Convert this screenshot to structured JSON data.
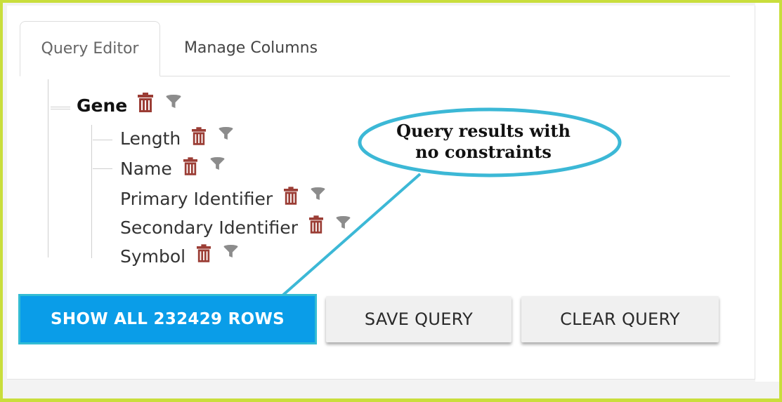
{
  "tabs": [
    {
      "label": "Query Editor",
      "active": true
    },
    {
      "label": "Manage Columns",
      "active": false
    }
  ],
  "tree": {
    "root": {
      "label": "Gene"
    },
    "children": [
      {
        "label": "Length"
      },
      {
        "label": "Name"
      },
      {
        "label": "Primary Identifier"
      },
      {
        "label": "Secondary Identifier"
      },
      {
        "label": "Symbol"
      }
    ]
  },
  "buttons": {
    "show_all": "SHOW ALL 232429 ROWS",
    "save_query": "SAVE QUERY",
    "clear_query": "CLEAR QUERY"
  },
  "callout": {
    "line1": "Query results with",
    "line2": "no constraints"
  },
  "icons": {
    "remove": "trash-icon",
    "constraint": "filter-icon"
  },
  "colors": {
    "frame_border": "#c9de3c",
    "primary_button": "#0a9de8",
    "callout_stroke": "#3cb8d6",
    "trash": "#9b3d35",
    "filter": "#8c8c8c"
  }
}
